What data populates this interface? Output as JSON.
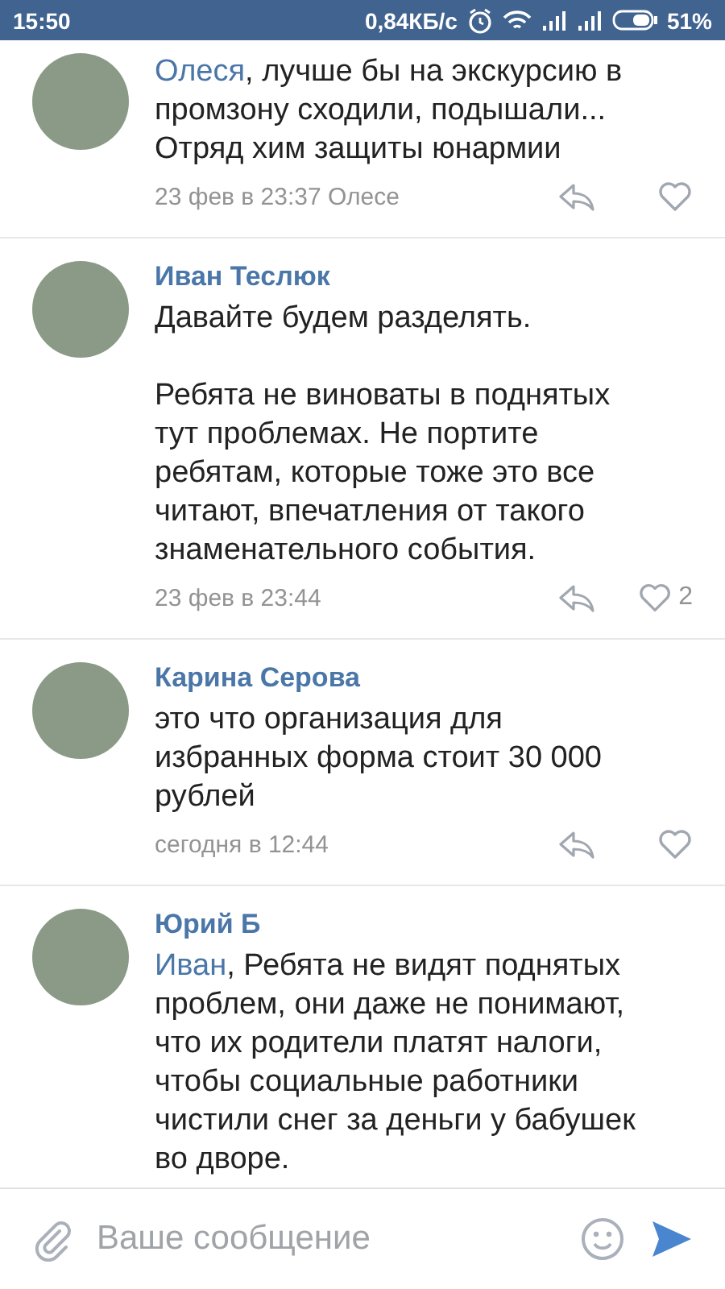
{
  "status_bar": {
    "time": "15:50",
    "speed": "0,84КБ/с",
    "battery": "51%"
  },
  "comments": [
    {
      "mention": "Олеся",
      "text": ", лучше бы на экскурсию в\nпромзону сходили, подышали...\nОтряд хим защиты юнармии",
      "meta": "23 фев в 23:37 Олесе"
    },
    {
      "author": "Иван Теслюк",
      "text": "Давайте будем разделять.\n\nРебята не виноваты в поднятых\nтут проблемах. Не портите\nребятам, которые тоже это все\nчитают, впечатления от такого\nзнаменательного события.",
      "meta": "23 фев в 23:44",
      "likes": "2"
    },
    {
      "author": "Карина Серова",
      "text": "это что организация для\nизбранных форма стоит 30 000\nрублей",
      "meta": "сегодня в 12:44"
    },
    {
      "author": "Юрий Б",
      "mention": "Иван",
      "text": ", Ребята не видят поднятых\nпроблем, они даже не понимают,\nчто их родители платят налоги,\nчтобы социальные работники\nчистили снег за деньги у бабушек\nво дворе."
    }
  ],
  "composer": {
    "placeholder": "Ваше сообщение"
  }
}
